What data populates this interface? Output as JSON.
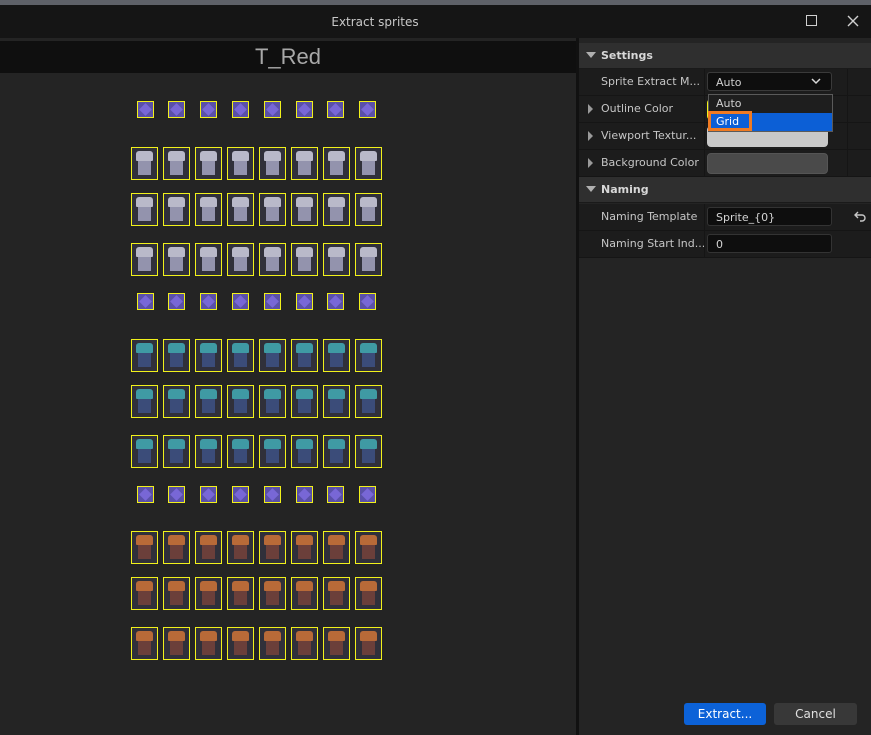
{
  "window": {
    "title": "Extract sprites",
    "maximize_icon": "maximize-icon",
    "close_icon": "close-icon"
  },
  "viewport": {
    "texture_name": "T_Red"
  },
  "details": {
    "settings_section": "Settings",
    "naming_section": "Naming",
    "rows": {
      "extract_mode": {
        "label": "Sprite Extract M...",
        "value": "Auto"
      },
      "outline_color": {
        "label": "Outline Color"
      },
      "viewport_texture": {
        "label": "Viewport Textur..."
      },
      "background_color": {
        "label": "Background Color"
      },
      "naming_template": {
        "label": "Naming Template",
        "value": "Sprite_{0}"
      },
      "naming_start_index": {
        "label": "Naming Start Ind...",
        "value": "0"
      }
    },
    "dropdown_options": [
      "Auto",
      "Grid"
    ],
    "highlighted_option": "Grid"
  },
  "colors": {
    "outline_color": "#f1f11b",
    "viewport_texture_color": "#c8c8c8",
    "background_color": "#4a4a4a",
    "accent": "#0c5fd6",
    "highlight": "#ef7a22"
  },
  "buttons": {
    "extract": "Extract...",
    "cancel": "Cancel"
  }
}
